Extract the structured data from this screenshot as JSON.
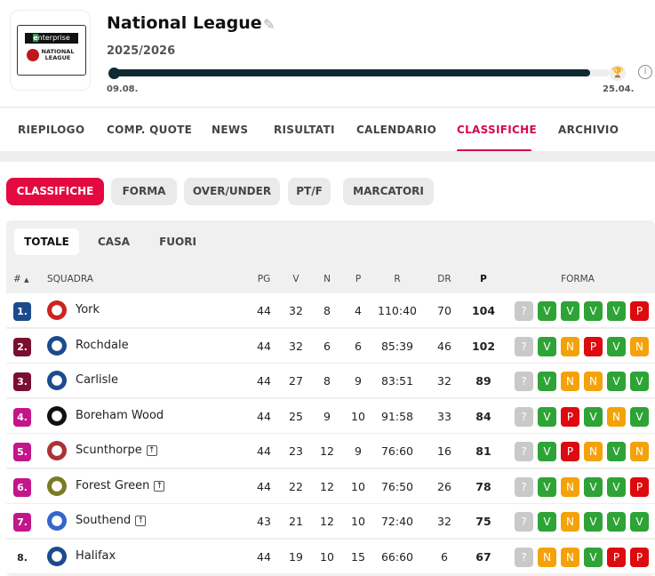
{
  "header": {
    "title": "National League",
    "season": "2025/2026",
    "start_date": "09.08.",
    "end_date": "25.04.",
    "progress": 0.96,
    "logo_text": [
      "enterprise",
      "NATIONAL LEAGUE"
    ],
    "icons": [
      "pin-icon",
      "trophy-icon",
      "info-icon"
    ]
  },
  "tabs": [
    "RIEPILOGO",
    "COMP. QUOTE",
    "NEWS",
    "RISULTATI",
    "CALENDARIO",
    "CLASSIFICHE",
    "ARCHIVIO"
  ],
  "active_tab": "CLASSIFICHE",
  "filters": [
    "CLASSIFICHE",
    "FORMA",
    "OVER/UNDER",
    "PT/F",
    "MARCATORI"
  ],
  "subtabs": [
    "TOTALE",
    "CASA",
    "FUORI"
  ],
  "columns": {
    "rank": "#",
    "team": "SQUADRA",
    "pg": "PG",
    "v": "V",
    "n": "N",
    "p": "P",
    "r": "R",
    "dr": "DR",
    "pts": "P",
    "form": "FORMA"
  },
  "colors": {
    "accent": "#d6094a",
    "win": "#2ea336",
    "draw": "#f4a20a",
    "loss": "#dd0a0f",
    "unknown": "#c9c9c9"
  },
  "rows": [
    {
      "rank": "1.",
      "team": "York",
      "pg": "44",
      "v": "32",
      "n": "8",
      "p": "4",
      "r": "110:40",
      "dr": "70",
      "pts": "104",
      "promo": false,
      "rank_color": "#1c4a8e",
      "form": [
        "?",
        "V",
        "V",
        "V",
        "V",
        "P"
      ]
    },
    {
      "rank": "2.",
      "team": "Rochdale",
      "pg": "44",
      "v": "32",
      "n": "6",
      "p": "6",
      "r": "85:39",
      "dr": "46",
      "pts": "102",
      "promo": false,
      "rank_color": "#7b0f31",
      "form": [
        "?",
        "V",
        "N",
        "P",
        "V",
        "N"
      ]
    },
    {
      "rank": "3.",
      "team": "Carlisle",
      "pg": "44",
      "v": "27",
      "n": "8",
      "p": "9",
      "r": "83:51",
      "dr": "32",
      "pts": "89",
      "promo": false,
      "rank_color": "#7b0f31",
      "form": [
        "?",
        "V",
        "N",
        "N",
        "V",
        "V"
      ]
    },
    {
      "rank": "4.",
      "team": "Boreham Wood",
      "pg": "44",
      "v": "25",
      "n": "9",
      "p": "10",
      "r": "91:58",
      "dr": "33",
      "pts": "84",
      "promo": false,
      "rank_color": "#c3168a",
      "form": [
        "?",
        "V",
        "P",
        "V",
        "N",
        "V"
      ]
    },
    {
      "rank": "5.",
      "team": "Scunthorpe",
      "pg": "44",
      "v": "23",
      "n": "12",
      "p": "9",
      "r": "76:60",
      "dr": "16",
      "pts": "81",
      "promo": true,
      "rank_color": "#c3168a",
      "form": [
        "?",
        "V",
        "P",
        "N",
        "V",
        "N"
      ]
    },
    {
      "rank": "6.",
      "team": "Forest Green",
      "pg": "44",
      "v": "22",
      "n": "12",
      "p": "10",
      "r": "76:50",
      "dr": "26",
      "pts": "78",
      "promo": true,
      "rank_color": "#c3168a",
      "form": [
        "?",
        "V",
        "N",
        "V",
        "V",
        "P"
      ]
    },
    {
      "rank": "7.",
      "team": "Southend",
      "pg": "43",
      "v": "21",
      "n": "12",
      "p": "10",
      "r": "72:40",
      "dr": "32",
      "pts": "75",
      "promo": true,
      "rank_color": "#c3168a",
      "form": [
        "?",
        "V",
        "N",
        "V",
        "V",
        "V"
      ]
    },
    {
      "rank": "8.",
      "team": "Halifax",
      "pg": "44",
      "v": "19",
      "n": "10",
      "p": "15",
      "r": "66:60",
      "dr": "6",
      "pts": "67",
      "promo": false,
      "rank_color": "",
      "form": [
        "?",
        "N",
        "N",
        "V",
        "P",
        "P"
      ]
    }
  ]
}
